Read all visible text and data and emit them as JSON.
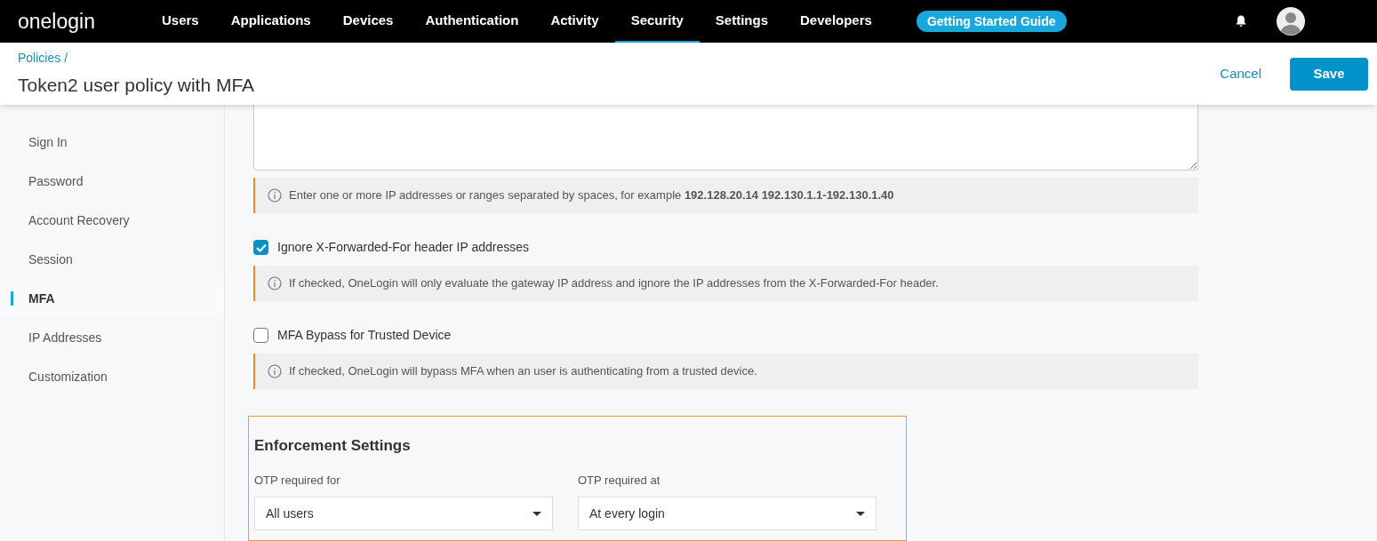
{
  "logo": "onelogin",
  "nav": [
    {
      "label": "Users",
      "selected": false
    },
    {
      "label": "Applications",
      "selected": false
    },
    {
      "label": "Devices",
      "selected": false
    },
    {
      "label": "Authentication",
      "selected": false
    },
    {
      "label": "Activity",
      "selected": false
    },
    {
      "label": "Security",
      "selected": true
    },
    {
      "label": "Settings",
      "selected": false
    },
    {
      "label": "Developers",
      "selected": false
    }
  ],
  "guide_button": "Getting Started Guide",
  "breadcrumb": "Policies /",
  "page_title": "Token2 user policy with MFA",
  "actions": {
    "cancel": "Cancel",
    "save": "Save"
  },
  "sidebar": [
    {
      "label": "Sign In",
      "selected": false
    },
    {
      "label": "Password",
      "selected": false
    },
    {
      "label": "Account Recovery",
      "selected": false
    },
    {
      "label": "Session",
      "selected": false
    },
    {
      "label": "MFA",
      "selected": true
    },
    {
      "label": "IP Addresses",
      "selected": false
    },
    {
      "label": "Customization",
      "selected": false
    }
  ],
  "ip_hint": "Enter one or more IP addresses or ranges separated by spaces, for example **192.128.20.14 192.130.1.1-192.130.1.40**",
  "options": [
    {
      "label": "Ignore X-Forwarded-For header IP addresses",
      "checked": true,
      "hint": "If checked, OneLogin will only evaluate the gateway IP address and ignore the IP addresses from the X-Forwarded-For header."
    },
    {
      "label": "MFA Bypass for Trusted Device",
      "checked": false,
      "hint": "If checked, OneLogin will bypass MFA when an user is authenticating from a trusted device."
    }
  ],
  "enforcement": {
    "title": "Enforcement Settings",
    "fields": [
      {
        "label": "OTP required for",
        "value": "All users"
      },
      {
        "label": "OTP required at",
        "value": "At every login"
      }
    ]
  }
}
